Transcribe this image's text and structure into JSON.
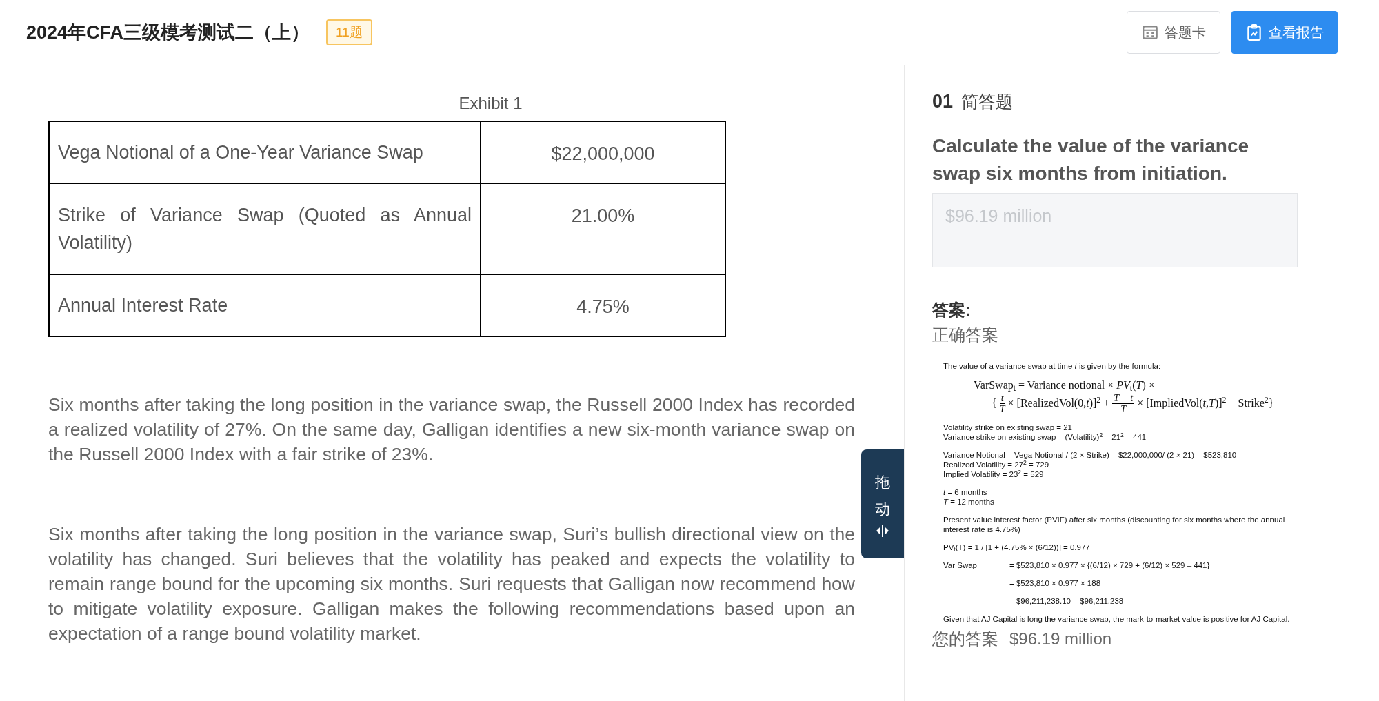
{
  "header": {
    "title": "2024年CFA三级模考测试二（上）",
    "count_badge": "11题",
    "buttons": [
      {
        "kind": "outline",
        "label": "答题卡"
      },
      {
        "kind": "primary",
        "label": "查看报告"
      }
    ]
  },
  "exhibit": {
    "caption": "Exhibit 1",
    "rows": [
      {
        "label": "Vega Notional of a One-Year Variance Swap",
        "value": "$22,000,000"
      },
      {
        "label": "Strike of Variance Swap (Quoted as Annual Volatility)",
        "value": "21.00%"
      },
      {
        "label": "Annual Interest Rate",
        "value": "4.75%"
      }
    ]
  },
  "paragraphs": [
    "Six months after taking the long position in the variance swap, the Russell 2000 Index has recorded a realized volatility of 27%. On the same day, Galligan identifies a new six-month variance swap on the Russell 2000 Index with a fair strike of 23%.",
    "Six months after taking the long position in the variance swap, Suri’s bullish directional view on the volatility has changed. Suri believes that the volatility has peaked and expects the volatility to remain range bound for the upcoming six months. Suri requests that Galligan now recommend how to mitigate volatility exposure. Galligan makes the following recommendations based upon an expectation of a range bound volatility market."
  ],
  "drag_handle": {
    "chars": [
      "拖",
      "动"
    ]
  },
  "question": {
    "number": "01",
    "type": "简答题",
    "prompt": "Calculate the value of the variance swap six months from initiation.",
    "answer_field": {
      "placeholder": "$96.19 million",
      "disabled": true
    }
  },
  "answer": {
    "heading": "答案:",
    "correct_label": "正确答案",
    "solution": [
      {
        "kind": "text",
        "text": "The value of a variance swap at time *t* is given by the formula:"
      },
      {
        "kind": "formula",
        "text": "VarSwap$_{t}$ = Variance notional × *PV*$_{t}$(*T*) ×"
      },
      {
        "kind": "formula_parts",
        "parts": [
          {
            "kind": "text",
            "text": "{"
          },
          {
            "kind": "frac",
            "num": "t",
            "den": "T"
          },
          {
            "kind": "text",
            "text": "× [RealizedVol(0,*t*)]$^{2}$ +"
          },
          {
            "kind": "frac",
            "num": "T − t",
            "den": "T"
          },
          {
            "kind": "text",
            "text": "× [ImpliedVol(*t*,*T*)]$^{2}$ − Strike$^{2}$}"
          }
        ]
      },
      {
        "kind": "text",
        "text": "Volatility strike on existing swap = 21"
      },
      {
        "kind": "text_tight",
        "text": "Variance strike on existing swap = (Volatility)$^{2}$ = 21$^{2}$ = 441"
      },
      {
        "kind": "text",
        "text": "Variance Notional = Vega Notional / (2 × Strike) = $22,000,000/ (2 × 21) = $523,810"
      },
      {
        "kind": "text_tight",
        "text": "Realized Volatility = 27$^{2}$ = 729"
      },
      {
        "kind": "text_tight",
        "text": "Implied Volatility = 23$^{2}$ = 529"
      },
      {
        "kind": "text",
        "text": "*t* = 6 months"
      },
      {
        "kind": "text_tight",
        "text": "*T* = 12 months"
      },
      {
        "kind": "text",
        "text": "Present value interest factor (PVIF) after six months (discounting for six months where the annual interest rate is 4.75%)"
      },
      {
        "kind": "text",
        "text": "PV$_{t}$(T) = 1 / [1 + (4.75% × (6/12))] = 0.977"
      },
      {
        "kind": "calc",
        "label": "Var Swap",
        "text": "= $523,810 × 0.977 × {(6/12) × 729 + (6/12) × 529 – 441}"
      },
      {
        "kind": "calc",
        "text": "= $523,810 × 0.977 × 188"
      },
      {
        "kind": "calc",
        "text": "= $96,211,238.10 = $96,211,238"
      },
      {
        "kind": "text",
        "text": "Given that AJ Capital is long the variance swap, the mark-to-market value is positive for AJ Capital."
      }
    ],
    "your_answer_label": "您的答案",
    "your_answer": "$96.19 million"
  }
}
